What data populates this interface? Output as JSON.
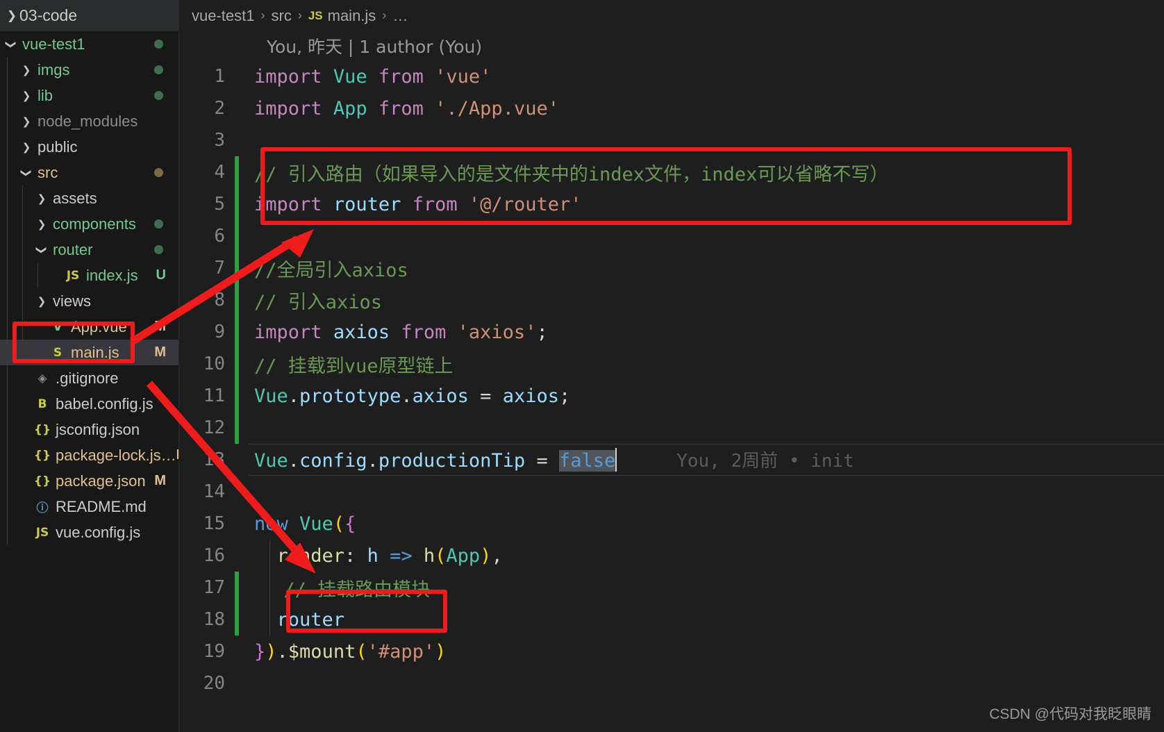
{
  "sidebar": {
    "header": {
      "label": "03-code",
      "icon": "chevron-right-icon"
    },
    "items": [
      {
        "label": "vue-test1",
        "indent": 0,
        "twisty": "chevron-down-icon",
        "icon": "",
        "iconclass": "",
        "labelclass": "c-green",
        "badge": "",
        "dot": "bg-green",
        "selected": false
      },
      {
        "label": "imgs",
        "indent": 1,
        "twisty": "chevron-right-icon",
        "icon": "",
        "iconclass": "",
        "labelclass": "c-green",
        "badge": "",
        "dot": "bg-green",
        "selected": false
      },
      {
        "label": "lib",
        "indent": 1,
        "twisty": "chevron-right-icon",
        "icon": "",
        "iconclass": "",
        "labelclass": "c-green",
        "badge": "",
        "dot": "bg-green",
        "selected": false
      },
      {
        "label": "node_modules",
        "indent": 1,
        "twisty": "chevron-right-icon",
        "icon": "",
        "iconclass": "",
        "labelclass": "c-gray",
        "badge": "",
        "dot": "",
        "selected": false
      },
      {
        "label": "public",
        "indent": 1,
        "twisty": "chevron-right-icon",
        "icon": "",
        "iconclass": "",
        "labelclass": "c-white",
        "badge": "",
        "dot": "",
        "selected": false
      },
      {
        "label": "src",
        "indent": 1,
        "twisty": "chevron-down-icon",
        "icon": "",
        "iconclass": "",
        "labelclass": "c-orange",
        "badge": "",
        "dot": "bg-olive",
        "selected": false
      },
      {
        "label": "assets",
        "indent": 2,
        "twisty": "chevron-right-icon",
        "icon": "",
        "iconclass": "",
        "labelclass": "c-white",
        "badge": "",
        "dot": "",
        "selected": false
      },
      {
        "label": "components",
        "indent": 2,
        "twisty": "chevron-right-icon",
        "icon": "",
        "iconclass": "",
        "labelclass": "c-green",
        "badge": "",
        "dot": "bg-green",
        "selected": false
      },
      {
        "label": "router",
        "indent": 2,
        "twisty": "chevron-down-icon",
        "icon": "",
        "iconclass": "",
        "labelclass": "c-green",
        "badge": "",
        "dot": "bg-green",
        "selected": false
      },
      {
        "label": "index.js",
        "indent": 3,
        "twisty": "",
        "icon": "JS",
        "iconclass": "c-yellow",
        "labelclass": "c-green",
        "badge": "U",
        "dot": "",
        "selected": false
      },
      {
        "label": "views",
        "indent": 2,
        "twisty": "chevron-right-icon",
        "icon": "",
        "iconclass": "",
        "labelclass": "c-white",
        "badge": "",
        "dot": "",
        "selected": false
      },
      {
        "label": "App.vue",
        "indent": 2,
        "twisty": "",
        "icon": "V",
        "iconclass": "c-green",
        "labelclass": "c-orange",
        "badge": "M",
        "dot": "",
        "selected": false
      },
      {
        "label": "main.js",
        "indent": 2,
        "twisty": "",
        "icon": "S",
        "iconclass": "c-yellow",
        "labelclass": "c-orange",
        "badge": "M",
        "dot": "",
        "selected": true
      },
      {
        "label": ".gitignore",
        "indent": 1,
        "twisty": "",
        "icon": "◈",
        "iconclass": "c-gray",
        "labelclass": "c-white",
        "badge": "",
        "dot": "",
        "selected": false
      },
      {
        "label": "babel.config.js",
        "indent": 1,
        "twisty": "",
        "icon": "B",
        "iconclass": "c-yellow",
        "labelclass": "c-white",
        "badge": "",
        "dot": "",
        "selected": false
      },
      {
        "label": "jsconfig.json",
        "indent": 1,
        "twisty": "",
        "icon": "{}",
        "iconclass": "c-yellow",
        "labelclass": "c-white",
        "badge": "",
        "dot": "",
        "selected": false
      },
      {
        "label": "package-lock.js…",
        "indent": 1,
        "twisty": "",
        "icon": "{}",
        "iconclass": "c-yellow",
        "labelclass": "c-orange",
        "badge": "M",
        "dot": "",
        "selected": false
      },
      {
        "label": "package.json",
        "indent": 1,
        "twisty": "",
        "icon": "{}",
        "iconclass": "c-yellow",
        "labelclass": "c-orange",
        "badge": "M",
        "dot": "",
        "selected": false
      },
      {
        "label": "README.md",
        "indent": 1,
        "twisty": "",
        "icon": "ⓘ",
        "iconclass": "c-blue",
        "labelclass": "c-white",
        "badge": "",
        "dot": "",
        "selected": false
      },
      {
        "label": "vue.config.js",
        "indent": 1,
        "twisty": "",
        "icon": "JS",
        "iconclass": "c-yellow",
        "labelclass": "c-white",
        "badge": "",
        "dot": "",
        "selected": false
      }
    ]
  },
  "breadcrumb": {
    "part1": "vue-test1",
    "part2": "src",
    "js_icon": "JS",
    "part3": "main.js",
    "ellipsis": "…",
    "sep": "›"
  },
  "blame_header": "You, 昨天 | 1 author (You)",
  "editor": {
    "line13_blame": "You, 2周前 • init",
    "lines": [
      {
        "n": "1",
        "changed": false,
        "indent": false
      },
      {
        "n": "2",
        "changed": false,
        "indent": false
      },
      {
        "n": "3",
        "changed": false,
        "indent": false
      },
      {
        "n": "4",
        "changed": true,
        "indent": false
      },
      {
        "n": "5",
        "changed": true,
        "indent": false
      },
      {
        "n": "6",
        "changed": true,
        "indent": false
      },
      {
        "n": "7",
        "changed": true,
        "indent": false
      },
      {
        "n": "8",
        "changed": true,
        "indent": false
      },
      {
        "n": "9",
        "changed": true,
        "indent": false
      },
      {
        "n": "10",
        "changed": true,
        "indent": false
      },
      {
        "n": "11",
        "changed": true,
        "indent": false
      },
      {
        "n": "12",
        "changed": true,
        "indent": false
      },
      {
        "n": "13",
        "changed": false,
        "indent": false
      },
      {
        "n": "14",
        "changed": false,
        "indent": false
      },
      {
        "n": "15",
        "changed": false,
        "indent": false
      },
      {
        "n": "16",
        "changed": false,
        "indent": true
      },
      {
        "n": "17",
        "changed": true,
        "indent": true
      },
      {
        "n": "18",
        "changed": true,
        "indent": true
      },
      {
        "n": "19",
        "changed": false,
        "indent": false
      },
      {
        "n": "20",
        "changed": false,
        "indent": false
      }
    ],
    "code": {
      "l1_kw_import": "import",
      "l1_cls": "Vue",
      "l1_kw_from": "from",
      "l1_str": "'vue'",
      "l2_kw_import": "import",
      "l2_cls": "App",
      "l2_kw_from": "from",
      "l2_str": "'./App.vue'",
      "l4_comment": "// 引入路由（如果导入的是文件夹中的index文件，index可以省略不写）",
      "l5_kw_import": "import",
      "l5_var": "router",
      "l5_kw_from": "from",
      "l5_str": "'@/router'",
      "l7_comment": "//全局引入axios",
      "l8_comment": "// 引入axios",
      "l9_kw_import": "import",
      "l9_var": "axios",
      "l9_kw_from": "from",
      "l9_str": "'axios'",
      "l9_semi": ";",
      "l10_comment": "// 挂载到vue原型链上",
      "l11_cls": "Vue",
      "l11_dot1": ".",
      "l11_prop1": "prototype",
      "l11_dot2": ".",
      "l11_prop2": "axios",
      "l11_eq": " = ",
      "l11_val": "axios",
      "l11_semi": ";",
      "l13_cls": "Vue",
      "l13_dot1": ".",
      "l13_prop1": "config",
      "l13_dot2": ".",
      "l13_prop2": "productionTip",
      "l13_eq": " = ",
      "l13_val": "false",
      "l15_kw_new": "new",
      "l15_cls": "Vue",
      "l15_paren": "(",
      "l15_brace": "{",
      "l16_prop": "  render",
      "l16_colon": ": ",
      "l16_h": "h",
      "l16_arrow": " => ",
      "l16_h2": "h",
      "l16_p1": "(",
      "l16_app": "App",
      "l16_p2": ")",
      "l16_comma": ",",
      "l17_comment": "// 挂载路由模块",
      "l18_router": "  router",
      "l19_brace": "}",
      "l19_paren": ")",
      "l19_dot": ".",
      "l19_mount": "$mount",
      "l19_p1": "(",
      "l19_str": "'#app'",
      "l19_p2": ")"
    }
  },
  "annotations": {
    "highlight_boxes": [
      "code-lines-4-5-highlight",
      "sidebar-main-js-highlight",
      "code-line-18-router-highlight"
    ],
    "arrows": [
      "arrow-mainjs-to-import-router",
      "arrow-mainjs-to-router-line"
    ],
    "accent_color": "#f01c1c"
  },
  "watermark": "CSDN @代码对我眨眼睛"
}
